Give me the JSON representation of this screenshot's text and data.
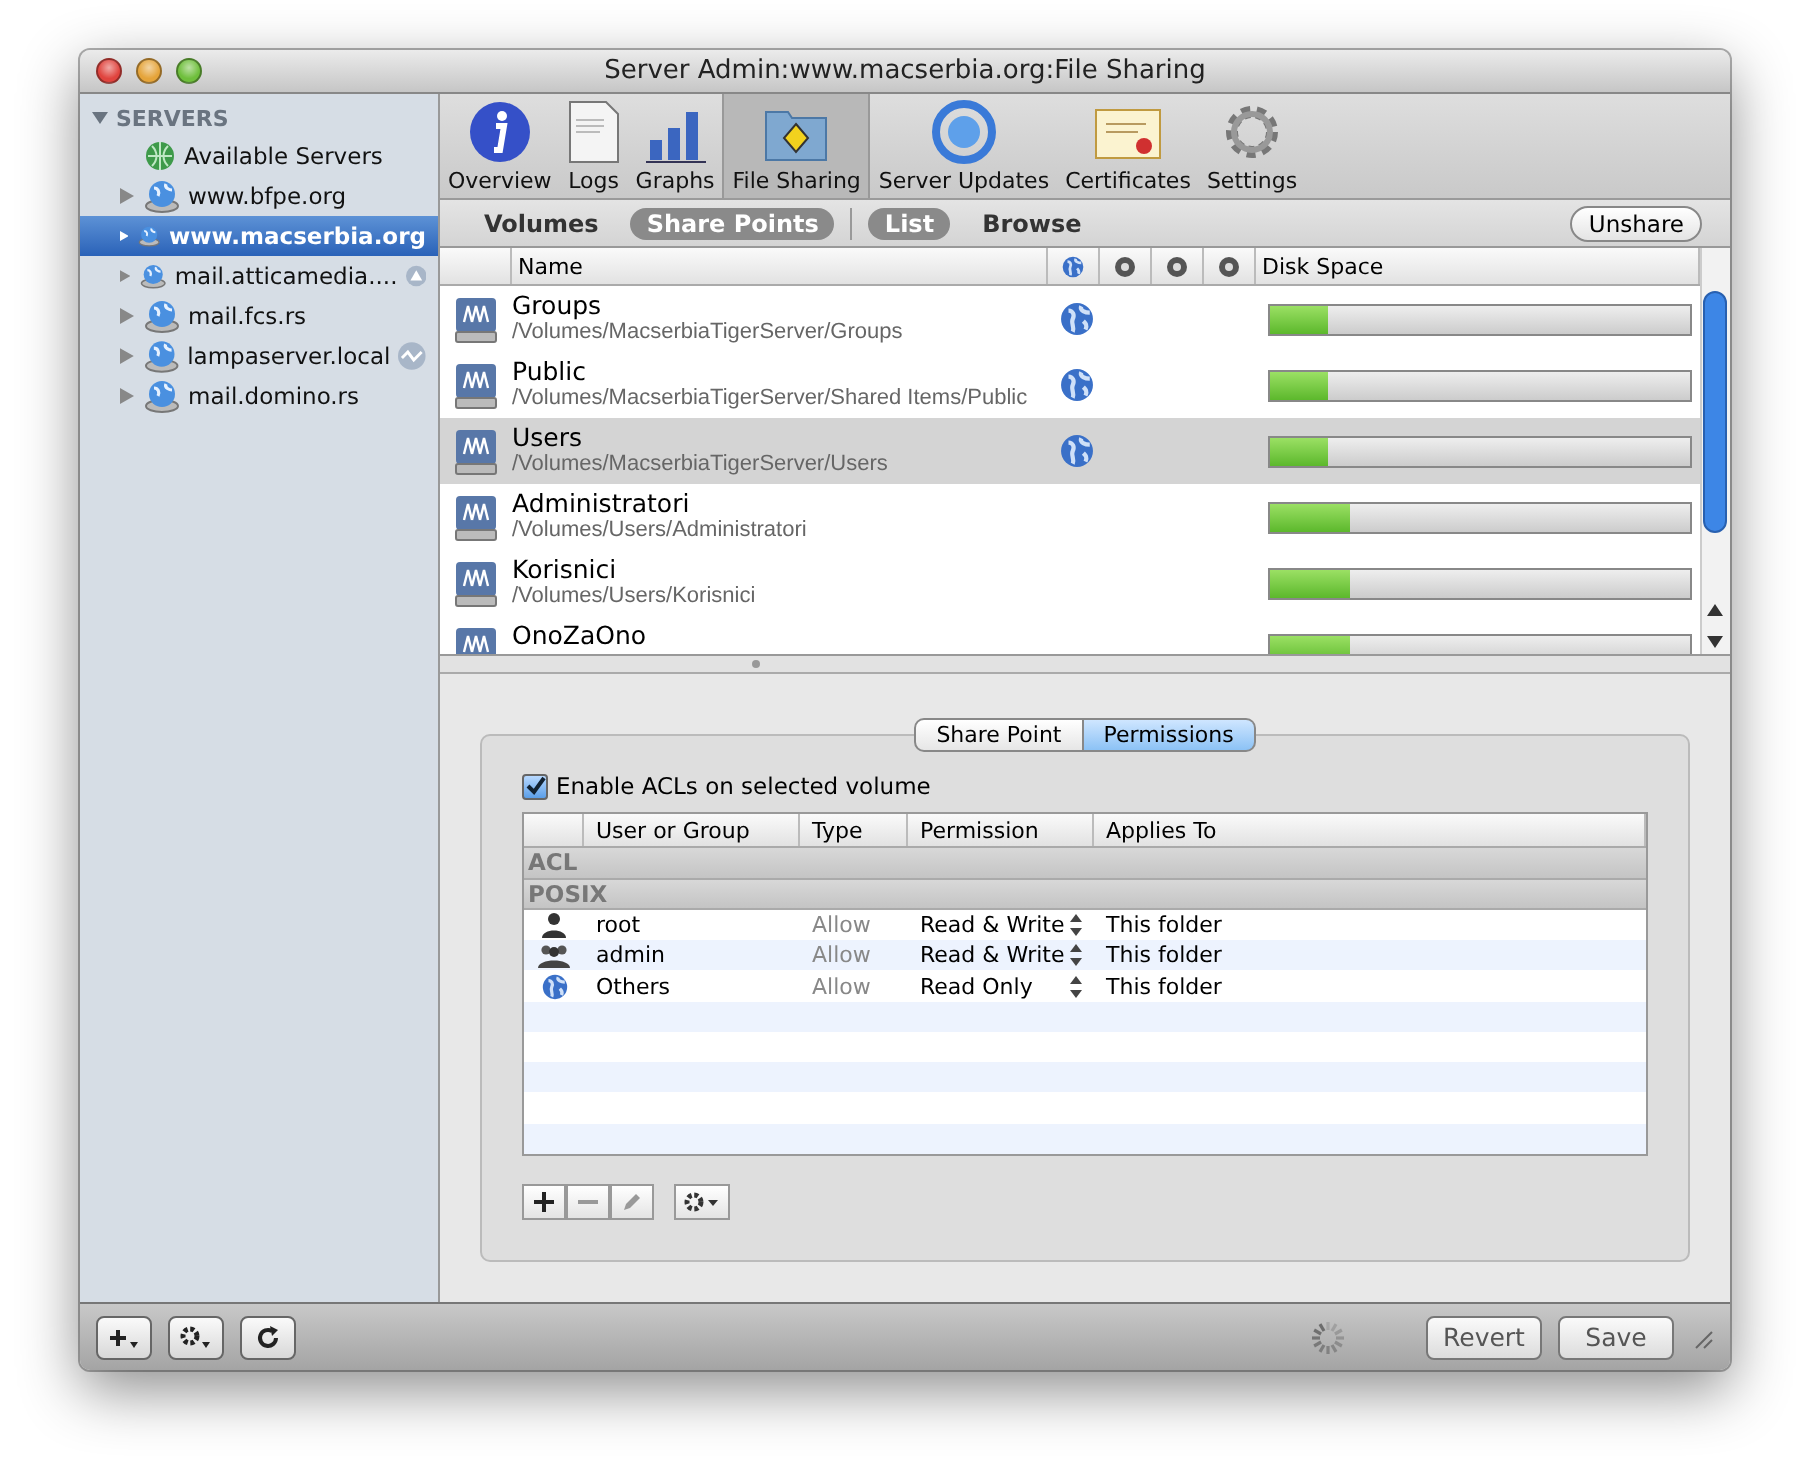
{
  "window": {
    "title": "Server Admin:www.macserbia.org:File Sharing"
  },
  "sidebar": {
    "header": "SERVERS",
    "items": [
      {
        "label": "Available Servers",
        "kind": "group",
        "selected": false
      },
      {
        "label": "www.bfpe.org",
        "kind": "server",
        "selected": false
      },
      {
        "label": "www.macserbia.org",
        "kind": "server",
        "selected": true
      },
      {
        "label": "mail.atticamedia....",
        "kind": "server",
        "selected": false,
        "badge": {
          "kind": "alert"
        }
      },
      {
        "label": "mail.fcs.rs",
        "kind": "server",
        "selected": false
      },
      {
        "label": "lampaserver.local",
        "kind": "server",
        "selected": false,
        "badge": {
          "kind": "activity"
        }
      },
      {
        "label": "mail.domino.rs",
        "kind": "server",
        "selected": false
      }
    ]
  },
  "toolbar": [
    {
      "label": "Overview",
      "kind": "info",
      "selected": false
    },
    {
      "label": "Logs",
      "kind": "doc",
      "selected": false
    },
    {
      "label": "Graphs",
      "kind": "bars",
      "selected": false
    },
    {
      "label": "File Sharing",
      "kind": "folder",
      "selected": true
    },
    {
      "label": "Server Updates",
      "kind": "update",
      "selected": false
    },
    {
      "label": "Certificates",
      "kind": "cert",
      "selected": false
    },
    {
      "label": "Settings",
      "kind": "gear",
      "selected": false
    }
  ],
  "view_bar": {
    "views": [
      {
        "label": "Volumes",
        "selected": false
      },
      {
        "label": "Share Points",
        "selected": true
      }
    ],
    "modes": [
      {
        "label": "List",
        "selected": true
      },
      {
        "label": "Browse",
        "selected": false
      }
    ],
    "button": "Unshare"
  },
  "share_table": {
    "columns": [
      "Name",
      "Disk Space"
    ],
    "rows": [
      {
        "name": "Groups",
        "path": "/Volumes/MacserbiaTigerServer/Groups",
        "shared": true,
        "level": 0.14,
        "selected": false
      },
      {
        "name": "Public",
        "path": "/Volumes/MacserbiaTigerServer/Shared Items/Public",
        "shared": true,
        "level": 0.14,
        "selected": false
      },
      {
        "name": "Users",
        "path": "/Volumes/MacserbiaTigerServer/Users",
        "shared": true,
        "level": 0.14,
        "selected": true
      },
      {
        "name": "Administratori",
        "path": "/Volumes/Users/Administratori",
        "shared": false,
        "level": 0.19,
        "selected": false
      },
      {
        "name": "Korisnici",
        "path": "/Volumes/Users/Korisnici",
        "shared": false,
        "level": 0.19,
        "selected": false
      },
      {
        "name": "OnoZaOno",
        "shared": false,
        "level": 0.19,
        "selected": false
      }
    ]
  },
  "detail_tabs": [
    {
      "label": "Share Point",
      "selected": false
    },
    {
      "label": "Permissions",
      "selected": true
    }
  ],
  "acl_checkbox": {
    "label": "Enable ACLs on selected volume",
    "checked": true
  },
  "perm_table": {
    "columns": [
      "User or Group",
      "Type",
      "Permission",
      "Applies To"
    ],
    "sections": [
      "ACL",
      "POSIX"
    ],
    "rows": [
      {
        "kind": "user",
        "name": "root",
        "type": "Allow",
        "permission": "Read & Write",
        "applies": "This folder"
      },
      {
        "kind": "group",
        "name": "admin",
        "type": "Allow",
        "permission": "Read & Write",
        "applies": "This folder"
      },
      {
        "kind": "globe",
        "name": "Others",
        "type": "Allow",
        "permission": "Read Only",
        "applies": "This folder"
      }
    ]
  },
  "footer": {
    "buttons": [
      "Revert",
      "Save"
    ]
  }
}
